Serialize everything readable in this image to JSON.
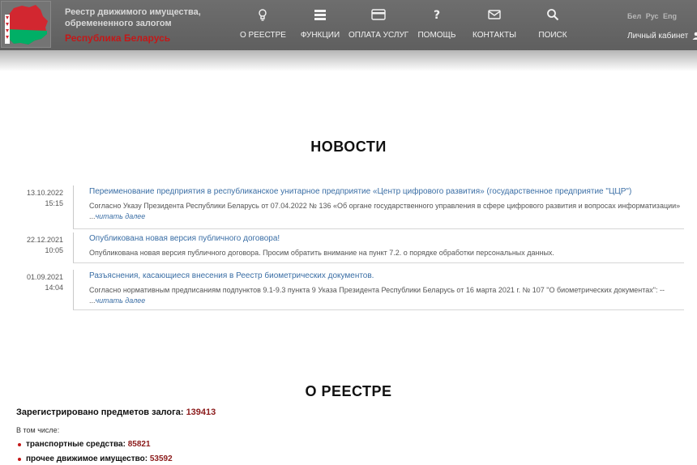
{
  "header": {
    "title_line1": "Реестр движимого имущества,",
    "title_line2": "обремененного залогом",
    "country": "Республика Беларусь",
    "nav": [
      {
        "label": "О РЕЕСТРЕ",
        "icon": "lightbulb-icon"
      },
      {
        "label": "ФУНКЦИИ",
        "icon": "server-icon"
      },
      {
        "label": "ОПЛАТА УСЛУГ",
        "icon": "credit-card-icon"
      },
      {
        "label": "ПОМОЩЬ",
        "icon": "question-icon"
      },
      {
        "label": "КОНТАКТЫ",
        "icon": "envelope-icon"
      },
      {
        "label": "ПОИСК",
        "icon": "search-icon"
      }
    ],
    "langs": [
      "Бел",
      "Рус",
      "Eng"
    ],
    "cabinet": "Личный кабинет",
    "colors": {
      "header_bg": "#6a6a6a",
      "country": "#c41818",
      "flag_red": "#d22730",
      "flag_green": "#00af66"
    }
  },
  "news": {
    "title": "НОВОСТИ",
    "items": [
      {
        "date": "13.10.2022",
        "time": "15:15",
        "title": "Переименование предприятия в республиканское унитарное предприятие «Центр цифрового развития» (государственное предприятие \"ЦЦР\")",
        "text": "Согласно Указу Президента Республики Беларусь от 07.04.2022 № 136 «Об органе государственного управления в сфере цифрового развития и вопросах информатизации» ...",
        "more": "читать далее"
      },
      {
        "date": "22.12.2021",
        "time": "10:05",
        "title": "Опубликована новая версия публичного договора!",
        "text": "Опубликована новая версия публичного договора. Просим обратить внимание на пункт 7.2. о порядке обработки персональных данных.",
        "more": ""
      },
      {
        "date": "01.09.2021",
        "time": "14:04",
        "title": "Разъяснения, касающиеся внесения в Реестр биометрических документов.",
        "text": "Согласно нормативным предписаниям подпунктов 9.1-9.3 пункта 9 Указа Президента Республики Беларусь от 16 марта 2021 г. № 107 \"О биометрических документах\": -- ...",
        "more": "читать далее"
      }
    ]
  },
  "about": {
    "title": "О РЕЕСТРЕ",
    "registered_label": "Зарегистрировано предметов залога:",
    "registered_value": "139413",
    "including": "В том числе:",
    "items": [
      {
        "label": "транспортные средства:",
        "value": "85821"
      },
      {
        "label": "прочее движимое имущество:",
        "value": "53592"
      }
    ]
  }
}
